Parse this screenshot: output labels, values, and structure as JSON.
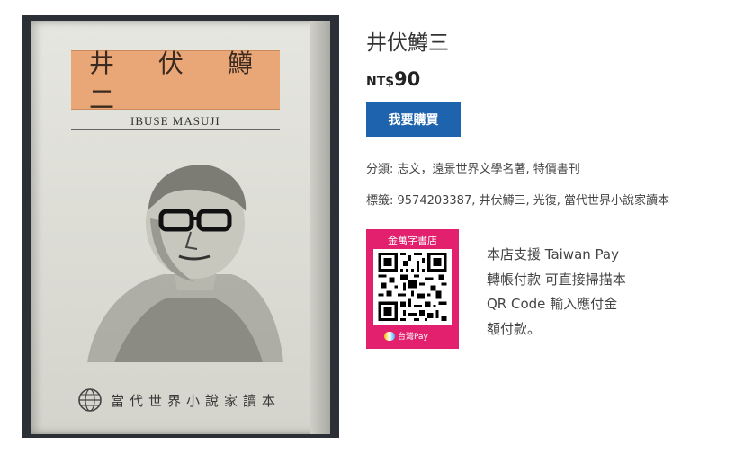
{
  "cover": {
    "title_text": "井 伏 鱒 二",
    "romaji": "IBUSE MASUJI",
    "series_text": "當代世界小說家讀本"
  },
  "product": {
    "title": "井伏鱒三",
    "price_currency": "NT$",
    "price_amount": "90",
    "buy_label": "我要購買",
    "category_line": "分類: 志文，遠景世界文學名著, 特價書刊",
    "tags_line": "標籤: 9574203387, 井伏鱒三, 光復, 當代世界小說家讀本"
  },
  "qr": {
    "store_name": "金萬字書店",
    "pay_label": "台灣Pay",
    "description": "本店支援 Taiwan Pay 轉帳付款 可直接掃描本 QR Code 輸入應付金額付款。"
  },
  "colors": {
    "buy_button": "#1d63ad",
    "qr_card": "#e2206e",
    "title_box": "#e9a676"
  }
}
